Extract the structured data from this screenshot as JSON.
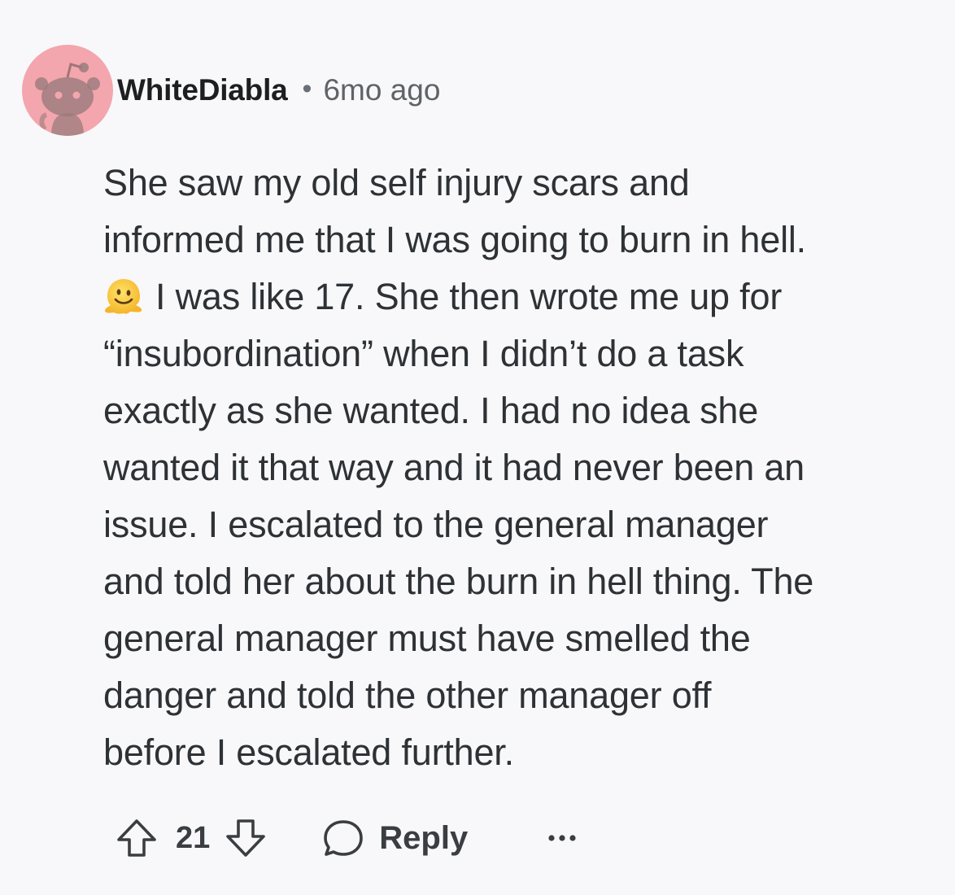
{
  "comment": {
    "username": "WhiteDiabla",
    "separator": "•",
    "timestamp": "6mo ago",
    "avatar_color": "#f3a6ad",
    "body_lines": [
      "She saw my old self injury scars and",
      "informed me that I was going to burn in hell.",
      "I was like 17. She then wrote me up for",
      "“insubordination” when I didn’t do a task",
      "exactly as she wanted. I had no idea she",
      "wanted it that way and it had never been an",
      "issue. I escalated to the general manager",
      "and told her about the burn in hell thing. The",
      "general manager must have smelled the",
      "danger and told the other manager off",
      "before I escalated further."
    ],
    "emoji": "melting-face-emoji"
  },
  "actions": {
    "score": "21",
    "reply_label": "Reply",
    "upvote_icon": "arrow-up-icon",
    "downvote_icon": "arrow-down-icon",
    "reply_icon": "speech-bubble-icon",
    "more_icon": "more-horizontal-icon"
  }
}
